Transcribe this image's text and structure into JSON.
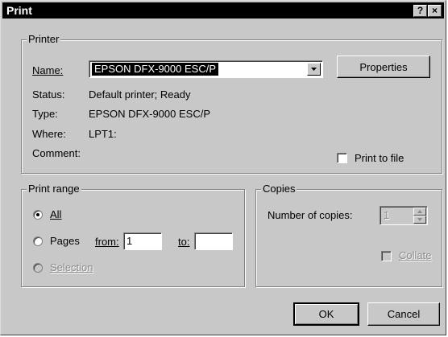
{
  "window": {
    "title": "Print",
    "help_button": "?",
    "close_button": "×"
  },
  "printer": {
    "group_label": "Printer",
    "name_label": "Name:",
    "name_value": "EPSON DFX-9000 ESC/P",
    "properties_label": "Properties",
    "status_label": "Status:",
    "status_value": "Default printer; Ready",
    "type_label": "Type:",
    "type_value": "EPSON DFX-9000 ESC/P",
    "where_label": "Where:",
    "where_value": "LPT1:",
    "comment_label": "Comment:",
    "comment_value": "",
    "print_to_file_label": "Print to file",
    "print_to_file_checked": false
  },
  "print_range": {
    "group_label": "Print range",
    "all_label": "All",
    "pages_label": "Pages",
    "from_label": "from:",
    "from_value": "1",
    "to_label": "to:",
    "to_value": "",
    "selection_label": "Selection",
    "selected": "all"
  },
  "copies": {
    "group_label": "Copies",
    "number_label": "Number of copies:",
    "number_value": "1",
    "collate_label": "Collate",
    "collate_enabled": false
  },
  "buttons": {
    "ok_label": "OK",
    "cancel_label": "Cancel"
  }
}
